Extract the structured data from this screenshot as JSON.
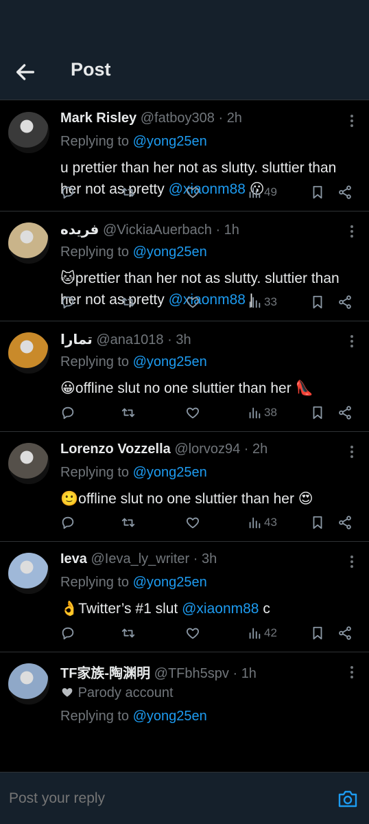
{
  "header": {
    "title": "Post"
  },
  "tweets": [
    {
      "name": "Mark Risley",
      "handle": "@fatboy308",
      "dot": "·",
      "time": "2h",
      "replying_prefix": "Replying to",
      "replying_to": "@yong25en",
      "text_before": "u prettier than her not as slutty. sluttier than her not as pretty",
      "mention": "@xiaonm88",
      "text_after": " 😗",
      "views": "49",
      "avatar_color": "#3a3a3a"
    },
    {
      "name": "فريده",
      "handle": "@VickiaAuerbach",
      "dot": "·",
      "time": "1h",
      "replying_prefix": "Replying to",
      "replying_to": "@yong25en",
      "text_before": "🐱prettier than her not as slutty. sluttier than her not as pretty",
      "mention": "@xiaonm88",
      "text_after": " |",
      "views": "33",
      "avatar_color": "#c9b48a"
    },
    {
      "name": "تمارا",
      "handle": "@ana1018",
      "dot": "·",
      "time": "3h",
      "replying_prefix": "Replying to",
      "replying_to": "@yong25en",
      "text_before": "😀offline slut no one sluttier than her 👠",
      "mention": "",
      "text_after": "",
      "views": "38",
      "avatar_color": "#c98a2a"
    },
    {
      "name": "Lorenzo Vozzella",
      "handle": "@lorvoz94",
      "dot": "·",
      "time": "2h",
      "replying_prefix": "Replying to",
      "replying_to": "@yong25en",
      "text_before": "🙂offline slut no one sluttier than her 😍",
      "mention": "",
      "text_after": "",
      "views": "43",
      "avatar_color": "#55504a"
    },
    {
      "name": "Ieva",
      "handle": "@Ieva_ly_writer",
      "dot": "·",
      "time": "3h",
      "replying_prefix": "Replying to",
      "replying_to": "@yong25en",
      "text_before": "👌Twitter’s #1 slut",
      "mention": "@xiaonm88",
      "text_after": " c",
      "views": "42",
      "avatar_color": "#9fb8d8"
    }
  ],
  "last_tweet": {
    "name": "TF家族-陶渊明",
    "handle": "@TFbh5spv",
    "dot": "·",
    "time": "1h",
    "parody_label": "Parody account",
    "replying_prefix": "Replying to",
    "replying_to": "@yong25en",
    "avatar_color": "#8fa8c8"
  },
  "composer": {
    "placeholder": "Post your reply"
  },
  "colors": {
    "accent": "#1d9bf0",
    "muted": "#71767b",
    "bar": "#15202b"
  }
}
